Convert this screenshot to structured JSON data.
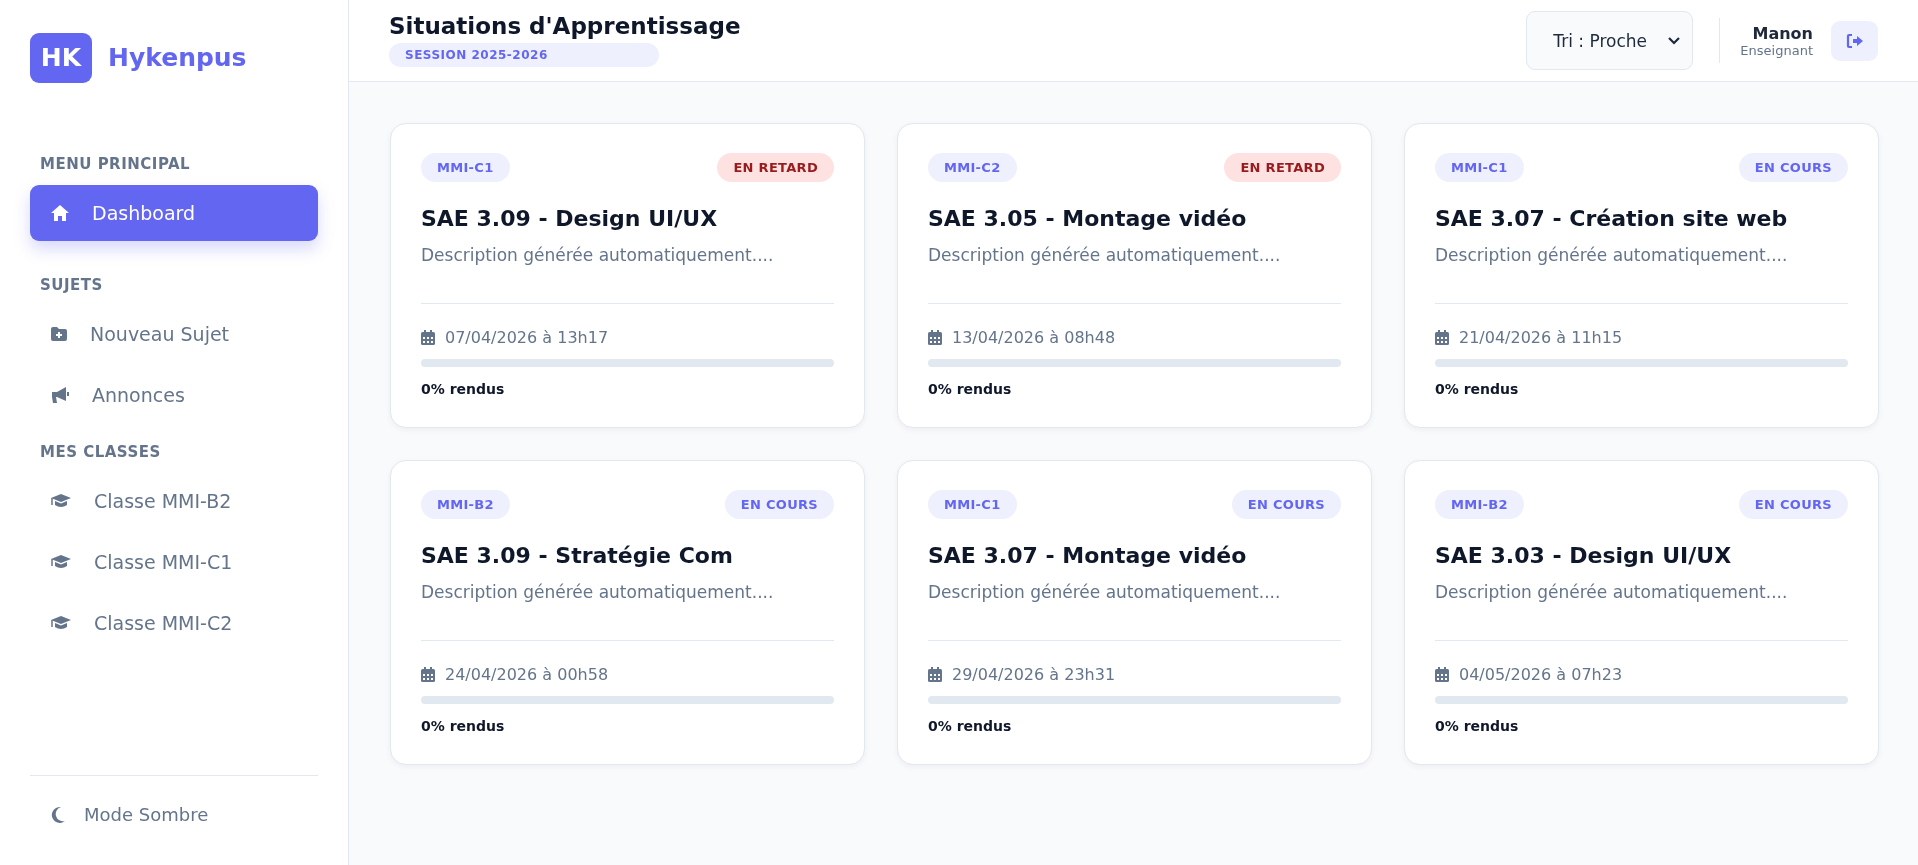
{
  "brand": {
    "logo": "HK",
    "name": "Hykenpus"
  },
  "sidebar": {
    "sections": [
      {
        "title": "MENU PRINCIPAL",
        "items": [
          {
            "kind": "home",
            "label": "Dashboard",
            "selected": true
          }
        ]
      },
      {
        "title": "SUJETS",
        "items": [
          {
            "kind": "folder-plus",
            "label": "Nouveau Sujet",
            "selected": false
          },
          {
            "kind": "megaphone",
            "label": "Annonces",
            "selected": false
          }
        ]
      },
      {
        "title": "MES CLASSES",
        "items": [
          {
            "kind": "class",
            "label": "Classe MMI-B2",
            "selected": false
          },
          {
            "kind": "class",
            "label": "Classe MMI-C1",
            "selected": false
          },
          {
            "kind": "class",
            "label": "Classe MMI-C2",
            "selected": false
          }
        ]
      }
    ],
    "footer": {
      "label": "Mode Sombre"
    }
  },
  "header": {
    "title": "Situations d'Apprentissage",
    "session": "SESSION 2025-2026",
    "sort": "Tri : Proche",
    "user": {
      "name": "Manon",
      "role": "Enseignant"
    }
  },
  "cards": [
    {
      "group": "MMI-C1",
      "status": {
        "kind": "late",
        "label": "EN RETARD"
      },
      "title": "SAE 3.09 - Design UI/UX",
      "description": "Description générée automatiquement....",
      "due": "07/04/2026 à 13h17",
      "level": 0,
      "progress": "0% rendus"
    },
    {
      "group": "MMI-C2",
      "status": {
        "kind": "late",
        "label": "EN RETARD"
      },
      "title": "SAE 3.05 - Montage vidéo",
      "description": "Description générée automatiquement....",
      "due": "13/04/2026 à 08h48",
      "level": 0,
      "progress": "0% rendus"
    },
    {
      "group": "MMI-C1",
      "status": {
        "kind": "ongoing",
        "label": "EN COURS"
      },
      "title": "SAE 3.07 - Création site web",
      "description": "Description générée automatiquement....",
      "due": "21/04/2026 à 11h15",
      "level": 0,
      "progress": "0% rendus"
    },
    {
      "group": "MMI-B2",
      "status": {
        "kind": "ongoing",
        "label": "EN COURS"
      },
      "title": "SAE 3.09 - Stratégie Com",
      "description": "Description générée automatiquement....",
      "due": "24/04/2026 à 00h58",
      "level": 0,
      "progress": "0% rendus"
    },
    {
      "group": "MMI-C1",
      "status": {
        "kind": "ongoing",
        "label": "EN COURS"
      },
      "title": "SAE 3.07 - Montage vidéo",
      "description": "Description générée automatiquement....",
      "due": "29/04/2026 à 23h31",
      "level": 0,
      "progress": "0% rendus"
    },
    {
      "group": "MMI-B2",
      "status": {
        "kind": "ongoing",
        "label": "EN COURS"
      },
      "title": "SAE 3.03 - Design UI/UX",
      "description": "Description générée automatiquement....",
      "due": "04/05/2026 à 07h23",
      "level": 0,
      "progress": "0% rendus"
    }
  ]
}
